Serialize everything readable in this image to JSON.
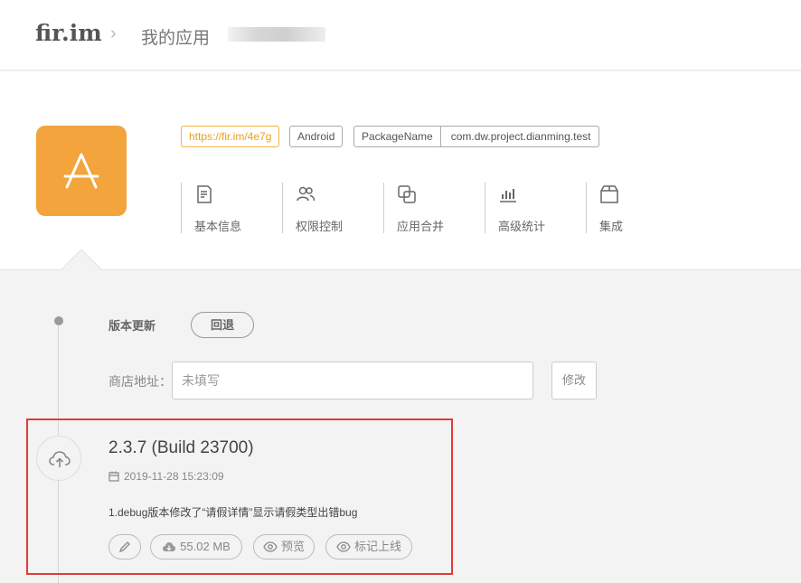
{
  "header": {
    "logo": "fir.im",
    "separator": "›",
    "breadcrumb": "我的应用"
  },
  "app": {
    "icon_letter": "A",
    "accent": "#f3a43c",
    "short_link": "https://fir.im/4e7g",
    "platform": "Android",
    "package_label": "PackageName",
    "package_value": "com.dw.project.dianming.test"
  },
  "nav": {
    "items": [
      {
        "label": "基本信息",
        "icon": "document-icon"
      },
      {
        "label": "权限控制",
        "icon": "users-icon"
      },
      {
        "label": "应用合并",
        "icon": "merge-icon"
      },
      {
        "label": "高级统计",
        "icon": "bar-chart-icon"
      },
      {
        "label": "集成",
        "icon": "box-icon"
      }
    ]
  },
  "versions": {
    "update_label": "版本更新",
    "rollback_label": "回退",
    "store_label": "商店地址：",
    "store_placeholder": "未填写",
    "store_edit_label": "修改"
  },
  "release": {
    "version": "2.3.7 (Build 23700)",
    "date": "2019-11-28 15:23:09",
    "note": "1.debug版本修改了“请假详情”显示请假类型出错bug",
    "size": "55.02 MB",
    "preview_label": "预览",
    "mark_online_label": "标记上线",
    "highlight_color": "#e53935"
  }
}
